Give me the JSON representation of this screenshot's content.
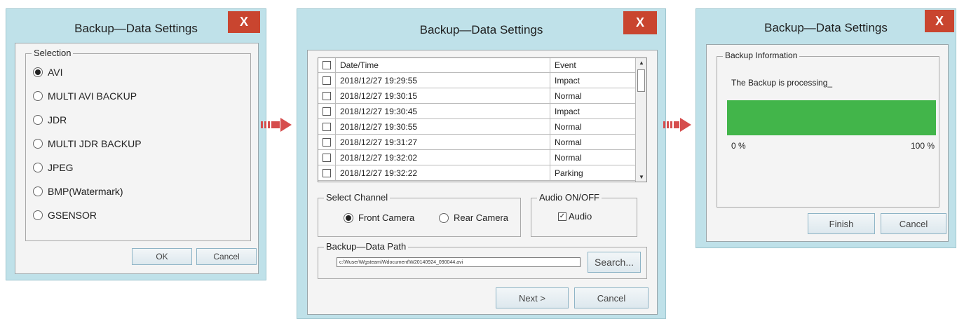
{
  "dialog1": {
    "title": "Backup—Data Settings",
    "close": "X",
    "group_label": "Selection",
    "options": [
      "AVI",
      "MULTI AVI BACKUP",
      "JDR",
      "MULTI JDR BACKUP",
      "JPEG",
      "BMP(Watermark)",
      "GSENSOR"
    ],
    "selected_index": 0,
    "ok": "OK",
    "cancel": "Cancel"
  },
  "dialog2": {
    "title": "Backup—Data Settings",
    "close": "X",
    "table": {
      "headers": [
        "Date/Time",
        "Event"
      ],
      "rows": [
        {
          "date": "2018/12/27 19:29:55",
          "event": "Impact"
        },
        {
          "date": "2018/12/27 19:30:15",
          "event": "Normal"
        },
        {
          "date": "2018/12/27 19:30:45",
          "event": "Impact"
        },
        {
          "date": "2018/12/27 19:30:55",
          "event": "Normal"
        },
        {
          "date": "2018/12/27 19:31:27",
          "event": "Normal"
        },
        {
          "date": "2018/12/27 19:32:02",
          "event": "Normal"
        },
        {
          "date": "2018/12/27 19:32:22",
          "event": "Parking"
        }
      ]
    },
    "channel_label": "Select Channel",
    "front_camera": "Front Camera",
    "rear_camera": "Rear Camera",
    "audio_label": "Audio ON/OFF",
    "audio": "Audio",
    "audio_checked": true,
    "path_label": "Backup—Data Path",
    "path_value": "c:\\Wuser\\Wgsteam\\Wdocument\\W20140924_090044.avi",
    "search": "Search...",
    "next": "Next >",
    "cancel": "Cancel"
  },
  "dialog3": {
    "title": "Backup—Data Settings",
    "close": "X",
    "group_label": "Backup Information",
    "status": "The Backup is processing_",
    "progress": 1.0,
    "progress_color": "#42b54a",
    "min_label": "0 %",
    "max_label": "100 %",
    "finish": "Finish",
    "cancel": "Cancel"
  },
  "colors": {
    "window_bg": "#bfe1e9",
    "close_bg": "#c9452f",
    "arrow": "#d64d4d"
  }
}
